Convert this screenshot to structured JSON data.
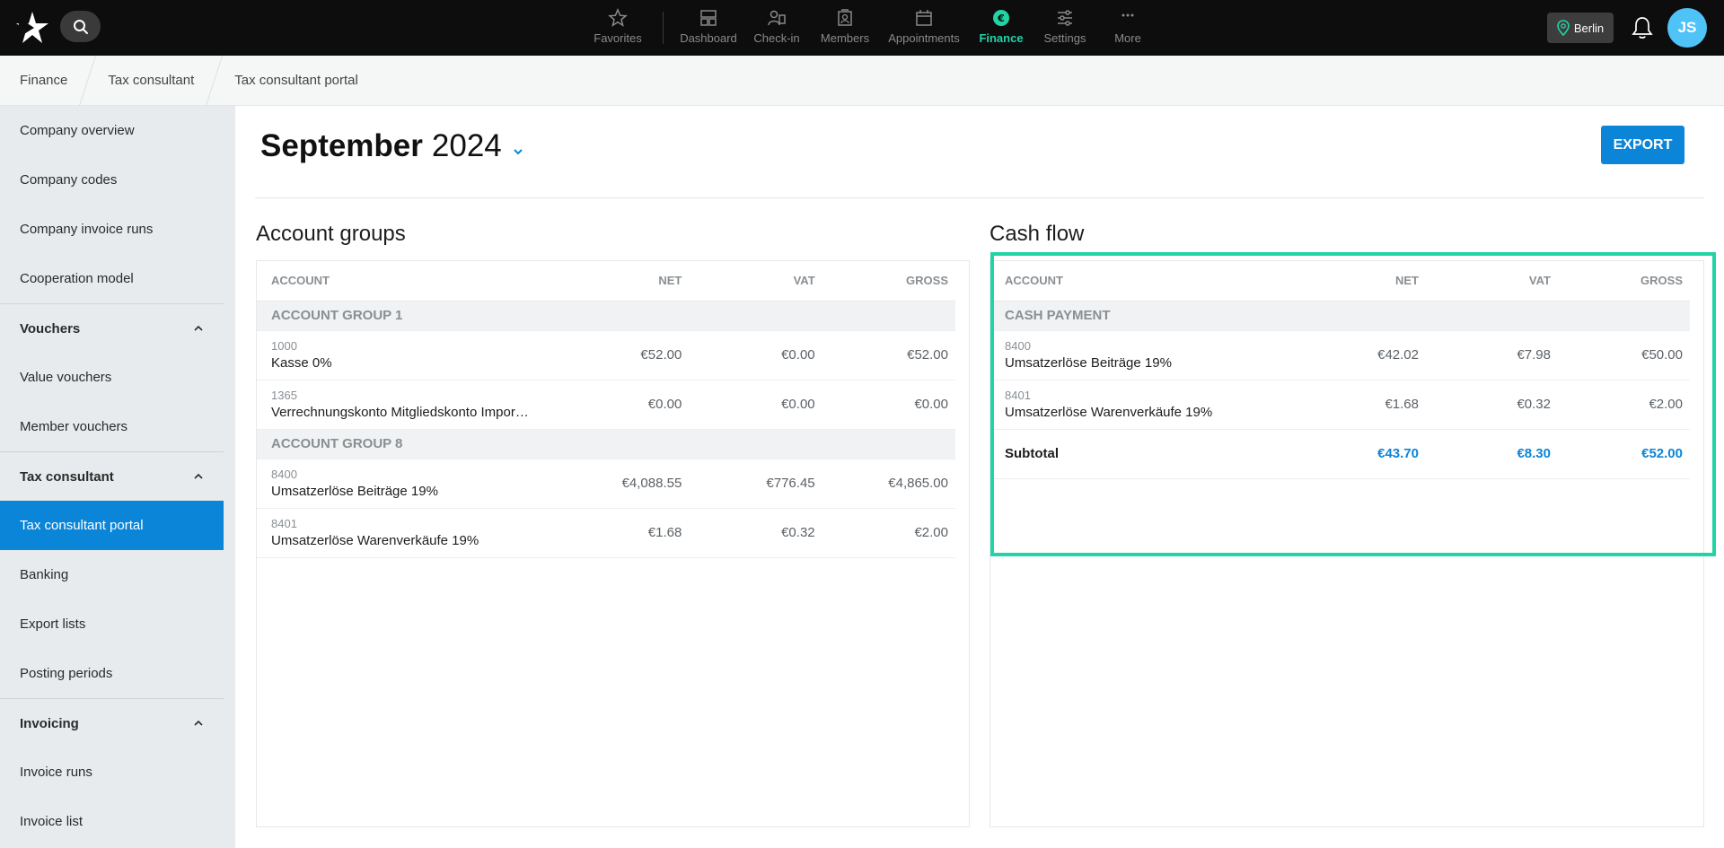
{
  "topbar": {
    "nav": [
      {
        "label": "Favorites",
        "icon": "star-icon",
        "active": false
      },
      {
        "label": "Dashboard",
        "icon": "dashboard-icon",
        "active": false
      },
      {
        "label": "Check-in",
        "icon": "check-in-icon",
        "active": false
      },
      {
        "label": "Members",
        "icon": "members-icon",
        "active": false
      },
      {
        "label": "Appointments",
        "icon": "calendar-icon",
        "active": false
      },
      {
        "label": "Finance",
        "icon": "euro-icon",
        "active": true
      },
      {
        "label": "Settings",
        "icon": "sliders-icon",
        "active": false
      },
      {
        "label": "More",
        "icon": "more-icon",
        "active": false
      }
    ],
    "location": "Berlin",
    "avatar_initials": "JS",
    "accent_color": "#22d3a6"
  },
  "breadcrumb": [
    "Finance",
    "Tax consultant",
    "Tax consultant portal"
  ],
  "sidebar": {
    "items": [
      {
        "label": "Company overview",
        "type": "item"
      },
      {
        "label": "Company codes",
        "type": "item"
      },
      {
        "label": "Company invoice runs",
        "type": "item"
      },
      {
        "label": "Cooperation model",
        "type": "item"
      },
      {
        "label": "Vouchers",
        "type": "section"
      },
      {
        "label": "Value vouchers",
        "type": "item"
      },
      {
        "label": "Member vouchers",
        "type": "item"
      },
      {
        "label": "Tax consultant",
        "type": "section"
      },
      {
        "label": "Tax consultant portal",
        "type": "item",
        "active": true
      },
      {
        "label": "Banking",
        "type": "item"
      },
      {
        "label": "Export lists",
        "type": "item"
      },
      {
        "label": "Posting periods",
        "type": "item"
      },
      {
        "label": "Invoicing",
        "type": "section"
      },
      {
        "label": "Invoice runs",
        "type": "item"
      },
      {
        "label": "Invoice list",
        "type": "item"
      }
    ]
  },
  "main": {
    "month": "September",
    "year": "2024",
    "export_label": "EXPORT"
  },
  "account_groups": {
    "title": "Account groups",
    "columns": [
      "ACCOUNT",
      "NET",
      "VAT",
      "GROSS"
    ],
    "groups": [
      {
        "name": "ACCOUNT GROUP 1",
        "rows": [
          {
            "code": "1000",
            "name": "Kasse 0%",
            "net": "€52.00",
            "vat": "€0.00",
            "gross": "€52.00"
          },
          {
            "code": "1365",
            "name": "Verrechnungskonto Mitgliedskonto Impor…",
            "net": "€0.00",
            "vat": "€0.00",
            "gross": "€0.00"
          }
        ]
      },
      {
        "name": "ACCOUNT GROUP 8",
        "rows": [
          {
            "code": "8400",
            "name": "Umsatzerlöse Beiträge 19%",
            "net": "€4,088.55",
            "vat": "€776.45",
            "gross": "€4,865.00"
          },
          {
            "code": "8401",
            "name": "Umsatzerlöse Warenverkäufe 19%",
            "net": "€1.68",
            "vat": "€0.32",
            "gross": "€2.00"
          }
        ]
      }
    ]
  },
  "cash_flow": {
    "title": "Cash flow",
    "columns": [
      "ACCOUNT",
      "NET",
      "VAT",
      "GROSS"
    ],
    "group": "CASH PAYMENT",
    "rows": [
      {
        "code": "8400",
        "name": "Umsatzerlöse Beiträge 19%",
        "net": "€42.02",
        "vat": "€7.98",
        "gross": "€50.00"
      },
      {
        "code": "8401",
        "name": "Umsatzerlöse Warenverkäufe 19%",
        "net": "€1.68",
        "vat": "€0.32",
        "gross": "€2.00"
      }
    ],
    "subtotal": {
      "label": "Subtotal",
      "net": "€43.70",
      "vat": "€8.30",
      "gross": "€52.00"
    }
  }
}
